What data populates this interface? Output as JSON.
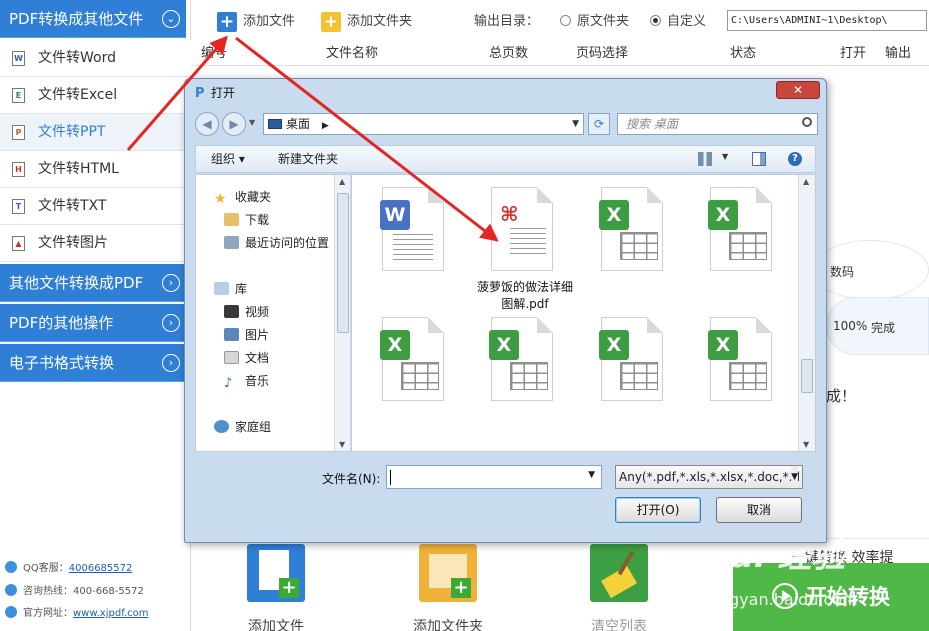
{
  "sidebar": {
    "header": "PDF转换成其他文件",
    "items": [
      {
        "label": "文件转Word",
        "icon": "word-file-icon",
        "glyph": "W"
      },
      {
        "label": "文件转Excel",
        "icon": "excel-file-icon",
        "glyph": "E"
      },
      {
        "label": "文件转PPT",
        "icon": "ppt-file-icon",
        "glyph": "P"
      },
      {
        "label": "文件转HTML",
        "icon": "html-file-icon",
        "glyph": "H"
      },
      {
        "label": "文件转TXT",
        "icon": "txt-file-icon",
        "glyph": "T"
      },
      {
        "label": "文件转图片",
        "icon": "image-file-icon",
        "glyph": "▲"
      }
    ],
    "categories": [
      "其他文件转换成PDF",
      "PDF的其他操作",
      "电子书格式转换"
    ],
    "contact": {
      "qq_label": "QQ客服：",
      "qq_value": "4006685572",
      "hotline_label": "咨询热线：",
      "hotline_value": "400-668-5572",
      "site_label": "官方网址：",
      "site_value": "www.xjpdf.com"
    }
  },
  "toolbar": {
    "add_file": "添加文件",
    "add_folder": "添加文件夹",
    "output_label": "输出目录：",
    "option_original": "原文件夹",
    "option_custom": "自定义",
    "selected_option": "自定义",
    "output_path": "C:\\Users\\ADMINI~1\\Desktop\\"
  },
  "table_headers": [
    "编号",
    "文件名称",
    "总页数",
    "页码选择",
    "状态",
    "打开",
    "输出"
  ],
  "background_fragments": {
    "digital_label": "数码",
    "progress": "100%",
    "progress_status": "完成",
    "done_text": "成！",
    "slogan": "一键转换  效率提"
  },
  "bottom_bar": {
    "add_file": "添加文件",
    "add_folder": "添加文件夹",
    "clear_list": "清空列表",
    "start": "开始转换"
  },
  "watermark": {
    "main": "Bai 经验",
    "sub": "jingyan.baidu.com"
  },
  "dialog": {
    "title": "打开",
    "close": "✕",
    "address": "桌面",
    "search_placeholder": "搜索 桌面",
    "organize": "组织 ▾",
    "new_folder": "新建文件夹",
    "nav": {
      "favorites": "收藏夹",
      "downloads": "下载",
      "recent": "最近访问的位置",
      "library": "库",
      "videos": "视频",
      "pictures": "图片",
      "documents": "文档",
      "music": "音乐",
      "homegroup": "家庭组"
    },
    "files": [
      {
        "type": "word",
        "name": ""
      },
      {
        "type": "pdf",
        "name": "菠萝饭的做法详细图解.pdf"
      },
      {
        "type": "excel",
        "name": ""
      },
      {
        "type": "excel",
        "name": ""
      },
      {
        "type": "excel",
        "name": ""
      },
      {
        "type": "excel",
        "name": ""
      },
      {
        "type": "excel",
        "name": ""
      },
      {
        "type": "excel",
        "name": ""
      }
    ],
    "filename_label": "文件名(N):",
    "filename_value": "",
    "filetype": "Any(*.pdf,*.xls,*.xlsx,*.doc,*.d",
    "open_button": "打开(O)",
    "cancel_button": "取消"
  },
  "colors": {
    "accent_blue": "#2f7fd6",
    "excel_green": "#3e9c42",
    "word_blue": "#4a72c4",
    "pdf_red": "#d8322b",
    "start_green": "#4fb847",
    "arrow_red": "#e52521"
  }
}
